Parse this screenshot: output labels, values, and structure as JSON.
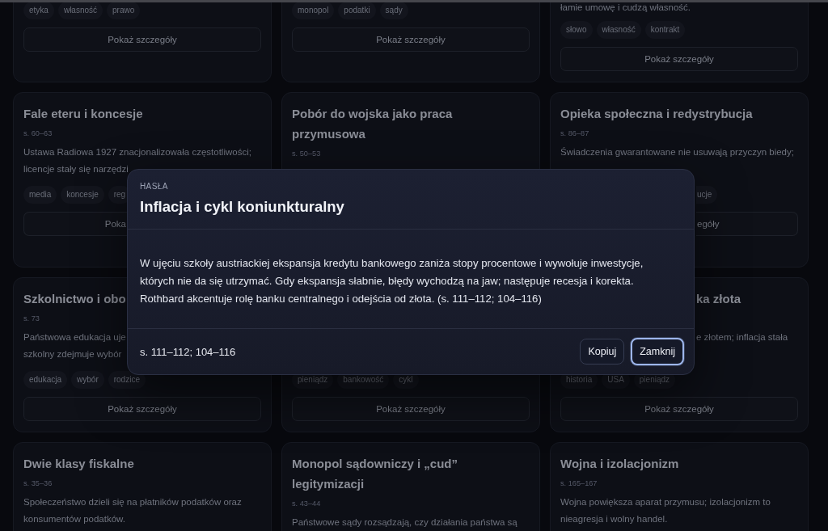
{
  "cards": [
    {
      "tags": [
        "etyka",
        "własność",
        "prawo"
      ],
      "button": "Pokaż szczegóły"
    },
    {
      "tags": [
        "monopol",
        "podatki",
        "sądy"
      ],
      "button": "Pokaż szczegóły"
    },
    {
      "description": "łamie umowę i cudzą własność.",
      "tags": [
        "słowo",
        "własność",
        "kontrakt"
      ],
      "button": "Pokaż szczegóły"
    },
    {
      "title": "Fale eteru i koncesje",
      "pages": "s. 60–63",
      "description": "Ustawa Radiowa 1927 znacjonalizowała częstotliwości; licencje stały się narzędzi",
      "tags": [
        "media",
        "koncesje",
        "reg"
      ],
      "button": "Poka",
      "button_clipped_right": true
    },
    {
      "title": "Pobór do wojska jako praca przymusowa",
      "pages": "s. 50–53"
    },
    {
      "title": "Opieka społeczna i redystrybucja",
      "pages": "s. 86–87",
      "description": "Świadczenia gwarantowane nie usuwają przyczyn biedy;",
      "tags": [
        "ucje"
      ],
      "tags_clipped_left": true,
      "button": "egóły",
      "button_clipped_left": true
    },
    {
      "title": "Szkolnictwo i obo",
      "pages": "s. 73",
      "description": "Państwowa edukacja uje\nszkolny zdejmuje wybór",
      "tags": [
        "edukacja",
        "wybór",
        "rodzice"
      ],
      "button": "Pokaż szczegóły"
    },
    {
      "tags": [
        "pieniądz",
        "bankowość",
        "cykl"
      ],
      "button": "Pokaż szczegóły"
    },
    {
      "title": "ka złota",
      "title_clipped_left": true,
      "description": "e złotem; inflacja stała",
      "description_clipped_left": true,
      "tags": [
        "historia",
        "USA",
        "pieniądz"
      ],
      "button": "Pokaż szczegóły"
    },
    {
      "title": "Dwie klasy fiskalne",
      "pages": "s. 35–36",
      "description": "Społeczeństwo dzieli się na płatników podatków oraz konsumentów podatków."
    },
    {
      "title": "Monopol sądowniczy i „cud” legitymizacji",
      "pages": "s. 43–44",
      "description": "Państwowe sądy rozsądzają, czy działania państwa są"
    },
    {
      "title": "Wojna i izolacjonizm",
      "pages": "s. 165–167",
      "description": "Wojna powiększa aparat przymusu; izolacjonizm to nieagresja i wolny handel."
    }
  ],
  "dialog": {
    "label": "HASŁA",
    "title": "Inflacja i cykl koniunkturalny",
    "body": "W ujęciu szkoły austriackiej ekspansja kredytu bankowego zaniża stopy procentowe i wywołuje inwestycje, których nie da się utrzymać. Gdy ekspansja słabnie, błędy wychodzą na jaw; następuje recesja i korekta. Rothbard akcentuje rolę banku centralnego i odejścia od złota. (s. 111–112; 104–116)",
    "pages": "s. 111–112; 104–116",
    "buttons": [
      {
        "label": "Kopiuj",
        "focused": false
      },
      {
        "label": "Zamknij",
        "focused": true
      }
    ]
  }
}
